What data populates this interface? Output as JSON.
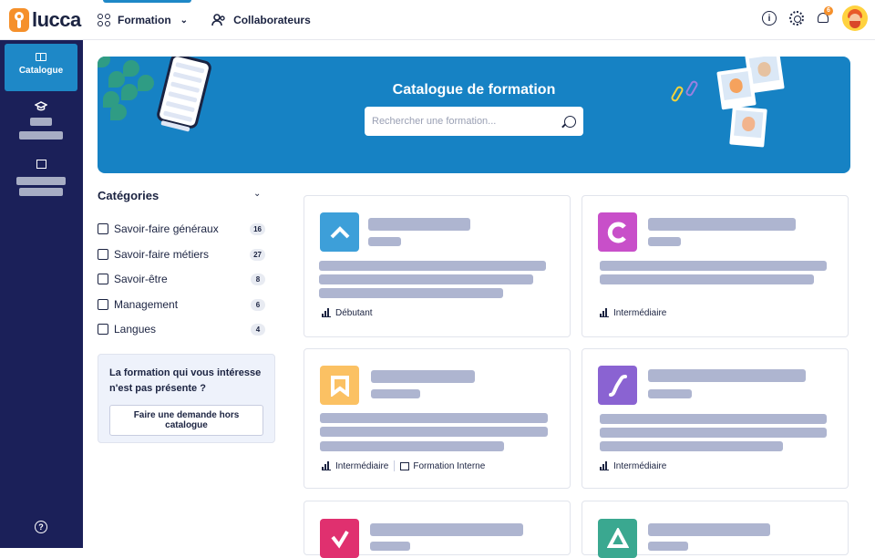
{
  "app": {
    "logo_text": "lucca"
  },
  "topnav": {
    "formation_label": "Formation",
    "collaborateurs_label": "Collaborateurs",
    "notification_count": "6"
  },
  "sidebar": {
    "active_label": "Catalogue",
    "help_glyph": "?"
  },
  "banner": {
    "title": "Catalogue de formation",
    "search_placeholder": "Rechercher une formation..."
  },
  "categories": {
    "title": "Catégories",
    "items": [
      {
        "label": "Savoir-faire généraux",
        "count": "16"
      },
      {
        "label": "Savoir-faire métiers",
        "count": "27"
      },
      {
        "label": "Savoir-être",
        "count": "8"
      },
      {
        "label": "Management",
        "count": "6"
      },
      {
        "label": "Langues",
        "count": "4"
      }
    ]
  },
  "request_box": {
    "text": "La formation qui vous intéresse n'est pas présente ?",
    "button_label": "Faire une demande hors catalogue"
  },
  "cards": [
    {
      "level": "Débutant",
      "color": "#3d9fd9"
    },
    {
      "level": "Intermédiaire",
      "color": "#c84fc9"
    },
    {
      "level": "Intermédiaire",
      "extra_tag": "Formation Interne",
      "color": "#fbc163"
    },
    {
      "level": "Intermédiaire",
      "color": "#8a63d2"
    },
    {
      "color": "#e0306f"
    },
    {
      "color": "#3aa890"
    }
  ],
  "icons": [
    "formation-grid-icon",
    "users-icon",
    "info-icon",
    "gear-icon",
    "bell-icon",
    "catalogue-book-icon",
    "graduation-cap-icon",
    "board-icon",
    "help-icon",
    "search-icon",
    "level-icon",
    "presentation-icon"
  ]
}
